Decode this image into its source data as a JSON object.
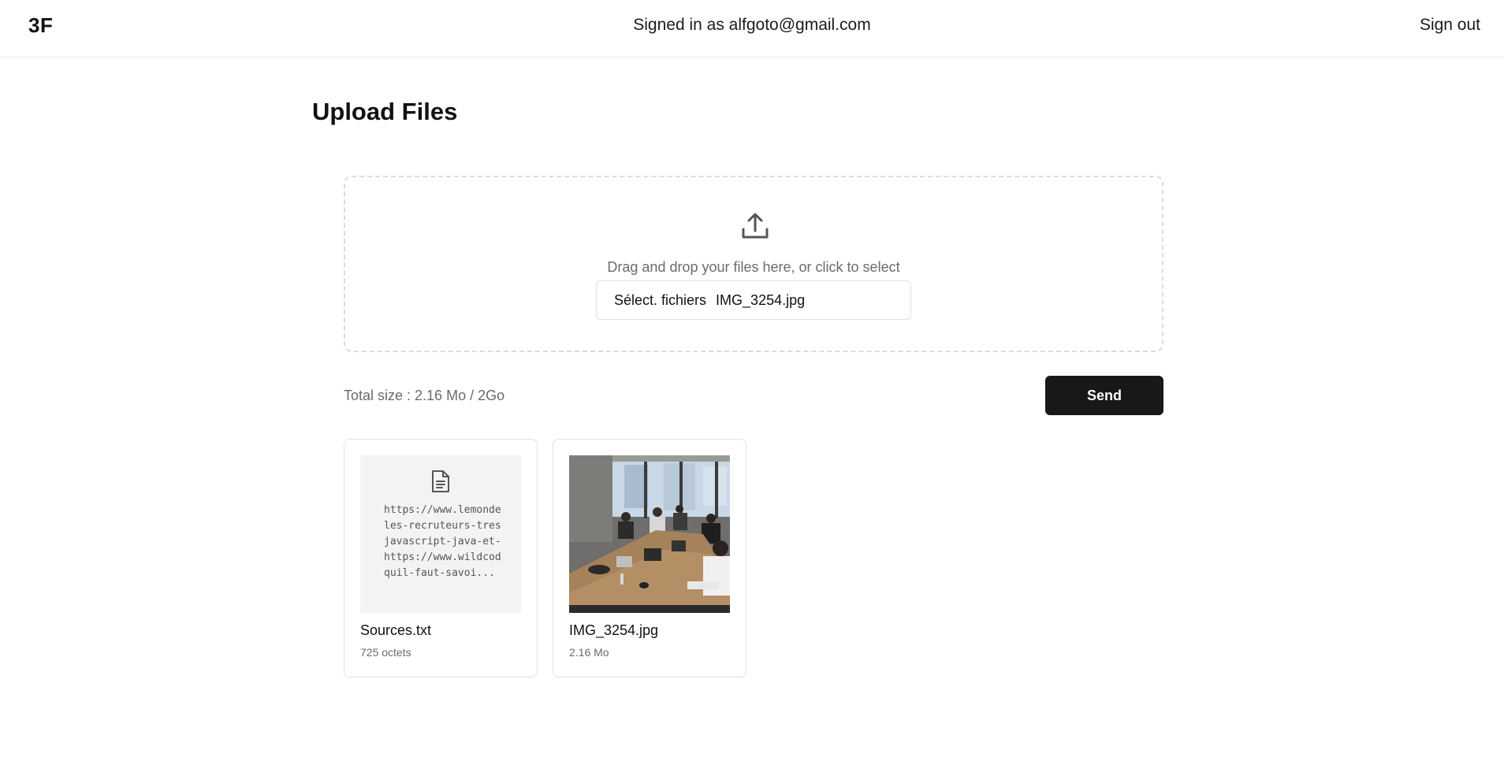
{
  "header": {
    "logo": "3F",
    "signed_in_text": "Signed in as alfgoto@gmail.com",
    "sign_out_label": "Sign out"
  },
  "page": {
    "title": "Upload Files"
  },
  "dropzone": {
    "icon": "upload-icon",
    "instruction": "Drag and drop your files here, or click to select",
    "file_input": {
      "button_label": "Sélect. fichiers",
      "selected_file": "IMG_3254.jpg"
    }
  },
  "summary": {
    "total_size": "Total size : 2.16 Mo / 2Go"
  },
  "actions": {
    "send_label": "Send"
  },
  "files": [
    {
      "name": "Sources.txt",
      "size": "725 octets",
      "type": "text",
      "icon": "document-icon",
      "preview_lines": [
        "https://www.lemonde",
        "les-recruteurs-tres",
        "javascript-java-et-",
        "https://www.wildcod",
        "quil-faut-savoi..."
      ]
    },
    {
      "name": "IMG_3254.jpg",
      "size": "2.16 Mo",
      "type": "image"
    }
  ],
  "colors": {
    "primary_button": "#181818",
    "muted_text": "#6b6b6b",
    "border": "#e2e2e2",
    "thumb_bg": "#f3f3f3"
  }
}
